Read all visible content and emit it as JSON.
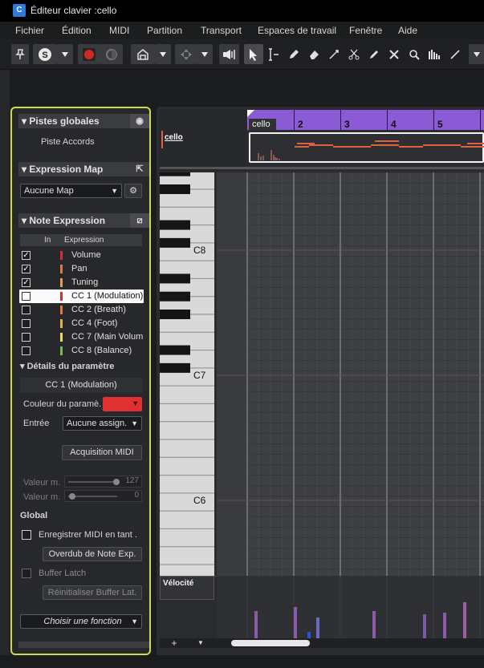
{
  "window": {
    "title": "Éditeur clavier :cello",
    "logo": "C"
  },
  "menu": [
    "Fichier",
    "Édition",
    "MIDI",
    "Partition",
    "Transport",
    "Espaces de travail",
    "Fenêtre",
    "Aide"
  ],
  "toolbar": {
    "icons": [
      "pin-icon",
      "solo-icon",
      "dropdown-icon",
      "record-icon",
      "monitor-icon",
      "autoscroll-icon",
      "dropdown-icon",
      "snap-icon",
      "dropdown-icon",
      "speaker-icon",
      "arrow-tool-icon",
      "range-tool-icon",
      "pencil-icon",
      "eraser-icon",
      "trim-icon",
      "scissors-icon",
      "glue-icon",
      "mute-icon",
      "zoom-icon",
      "comp-icon",
      "line-icon",
      "dropdown-icon"
    ]
  },
  "inspector": {
    "global_tracks": {
      "title": "Pistes globales",
      "item": "Piste Accords"
    },
    "expression_map": {
      "title": "Expression Map",
      "value": "Aucune Map"
    },
    "note_expression": {
      "title": "Note Expression",
      "col_in": "In",
      "col_expr": "Expression",
      "rows": [
        {
          "checked": true,
          "label": "Volume",
          "color": "#d03030"
        },
        {
          "checked": true,
          "label": "Pan",
          "color": "#e07a3a"
        },
        {
          "checked": true,
          "label": "Tuning",
          "color": "#e8a040"
        },
        {
          "checked": false,
          "label": "CC 1  (Modulation)",
          "color": "#d03030",
          "selected": true
        },
        {
          "checked": false,
          "label": "CC 2  (Breath)",
          "color": "#e07a3a"
        },
        {
          "checked": false,
          "label": "CC 4  (Foot)",
          "color": "#e8b040"
        },
        {
          "checked": false,
          "label": "CC 7  (Main Volum",
          "color": "#e8e050"
        },
        {
          "checked": false,
          "label": "CC 8  (Balance)",
          "color": "#70c050"
        }
      ]
    },
    "param_details": {
      "title": "Détails du paramètre",
      "selected": "CC 1  (Modulation)",
      "color_label": "Couleur du paramè.",
      "color_value": "#e03030",
      "input_label": "Entrée",
      "input_value": "Aucune assign.",
      "acq_button": "Acquisition MIDI",
      "val_max_label": "Valeur m.",
      "val_max": "127",
      "val_min_label": "Valeur m.",
      "val_min": "0"
    },
    "global": {
      "title": "Global",
      "record_label": "Enregistrer MIDI en tant .",
      "overdub_button": "Overdub de Note Exp.",
      "latch_label": "Buffer Latch",
      "reset_button": "Réinitialiser Buffer Lat.",
      "function_select": "Choisir une fonction"
    }
  },
  "editor": {
    "track_name": "cello",
    "part_name": "cello",
    "bars": [
      "2",
      "3",
      "4",
      "5"
    ],
    "octaves": [
      "C8",
      "C7",
      "C6"
    ],
    "velocity_label": "Vélocité",
    "add_lane": "+",
    "lane_menu": "▼"
  }
}
